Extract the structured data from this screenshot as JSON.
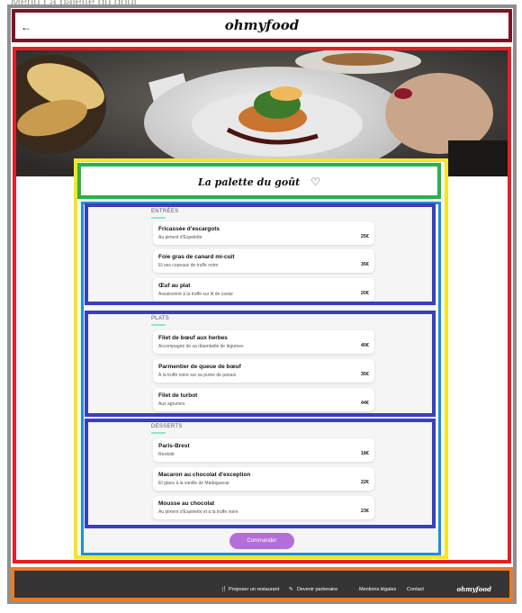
{
  "page_caption": "Menu La palette du goût",
  "header": {
    "back_icon": "←",
    "logo": "ohmyfood"
  },
  "restaurant": {
    "title": "La palette du goût",
    "heart_icon": "♡"
  },
  "menu": {
    "sections": [
      {
        "title": "ENTRÉES",
        "dishes": [
          {
            "name": "Fricassée d'escargots",
            "desc": "Au piment d'Espelette",
            "price": "25€"
          },
          {
            "name": "Foie gras de canard mi-cuit",
            "desc": "Et ses copeaux de truffe noire",
            "price": "35€"
          },
          {
            "name": "Œuf au plat",
            "desc": "Assaisonné à la truffe sur lit de caviar",
            "price": "20€"
          }
        ]
      },
      {
        "title": "PLATS",
        "dishes": [
          {
            "name": "Filet de bœuf aux herbes",
            "desc": "Accompagné de sa ribambelle de légumes",
            "price": "40€"
          },
          {
            "name": "Parmentier de queue de bœuf",
            "desc": "À la truffe noire sur sa purée de panais",
            "price": "35€"
          },
          {
            "name": "Filet de turbot",
            "desc": "Aux agrumes",
            "price": "44€"
          }
        ]
      },
      {
        "title": "DESSERTS",
        "dishes": [
          {
            "name": "Paris-Brest",
            "desc": "Revisité",
            "price": "18€"
          },
          {
            "name": "Macaron au chocolat d'exception",
            "desc": "Et glace à la vanille de Madagascar",
            "price": "22€"
          },
          {
            "name": "Mousse au chocolat",
            "desc": "Au piment d'Espelette et à la truffe noire",
            "price": "23€"
          }
        ]
      }
    ],
    "order_button": "Commander"
  },
  "footer": {
    "propose_icon": "🍴",
    "propose": "Proposer un restaurant",
    "partner_icon": "✎",
    "partner": "Devenir partenaire",
    "legal": "Mentions légales",
    "contact": "Contact",
    "logo": "ohmyfood"
  },
  "colors": {
    "accent": "#b46ed9",
    "section_underline": "#99e2d0",
    "footer_bg": "#353535"
  }
}
